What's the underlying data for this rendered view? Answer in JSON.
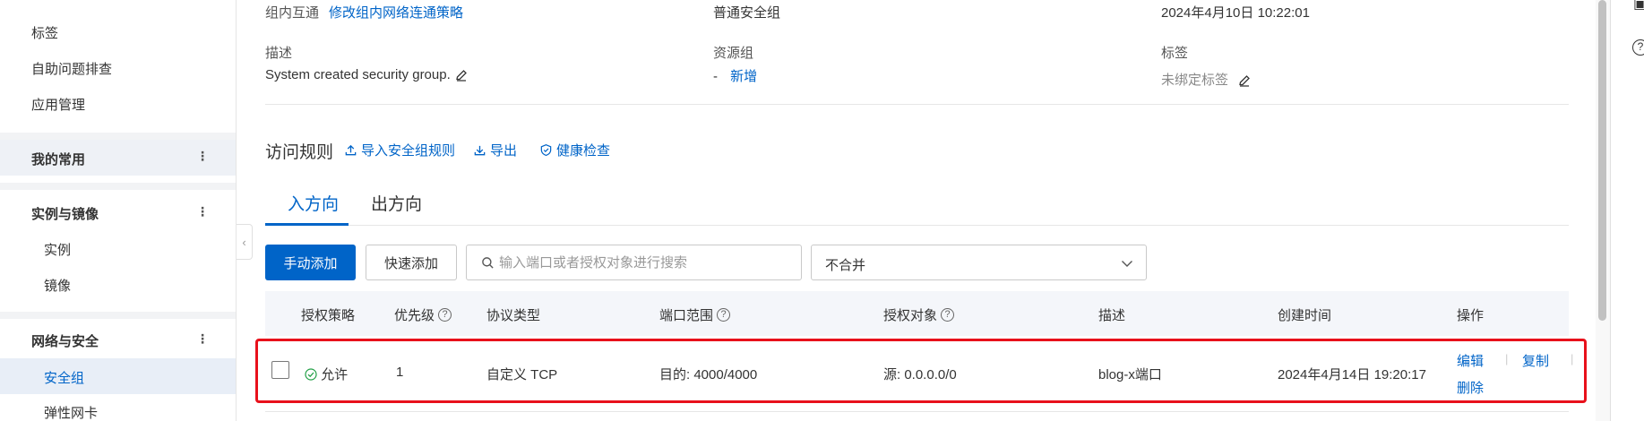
{
  "sidebar": {
    "items": [
      {
        "label": "标签"
      },
      {
        "label": "自助问题排查"
      },
      {
        "label": "应用管理"
      }
    ],
    "groups": [
      {
        "label": "我的常用"
      },
      {
        "label": "实例与镜像",
        "children": [
          "实例",
          "镜像"
        ]
      },
      {
        "label": "网络与安全",
        "children": [
          "安全组",
          "弹性网卡"
        ]
      }
    ],
    "group_menu_icon": "more-vertical-icon",
    "collapse_icon": "chevron-left-icon"
  },
  "info": {
    "intra_group_label": "组内互通",
    "intra_group_link": "修改组内网络连通策略",
    "group_type": "普通安全组",
    "created_time": "2024年4月10日 10:22:01",
    "desc_label": "描述",
    "desc_value": "System created security group.",
    "resource_group_label": "资源组",
    "resource_group_value": "-",
    "resource_group_add": "新增",
    "tags_label": "标签",
    "tags_value": "未绑定标签"
  },
  "rules": {
    "title": "访问规则",
    "actions": [
      {
        "label": "导入安全组规则",
        "icon": "upload-icon"
      },
      {
        "label": "导出",
        "icon": "download-icon"
      },
      {
        "label": "健康检查",
        "icon": "shield-check-icon"
      }
    ],
    "tabs": [
      {
        "label": "入方向",
        "active": true
      },
      {
        "label": "出方向",
        "active": false
      }
    ],
    "add_manual": "手动添加",
    "add_quick": "快速添加",
    "search_placeholder": "输入端口或者授权对象进行搜索",
    "merge_select": "不合并",
    "columns": [
      "授权策略",
      "优先级",
      "协议类型",
      "端口范围",
      "授权对象",
      "描述",
      "创建时间",
      "操作"
    ],
    "rows": [
      {
        "policy": "允许",
        "priority": "1",
        "protocol": "自定义 TCP",
        "port_range": "目的: 4000/4000",
        "source": "源: 0.0.0.0/0",
        "description": "blog-x端口",
        "created": "2024年4月14日 19:20:17",
        "ops": [
          "编辑",
          "复制",
          "删除"
        ]
      }
    ]
  },
  "colors": {
    "accent": "#0064c8",
    "highlight": "#e8111b",
    "success": "#23a047"
  }
}
